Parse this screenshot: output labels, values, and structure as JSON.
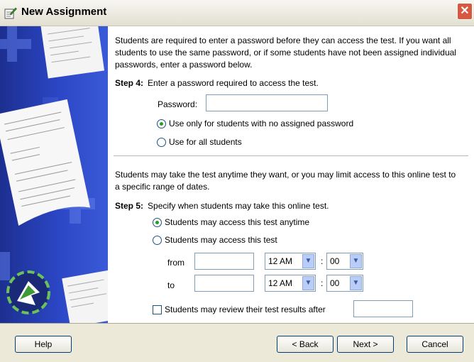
{
  "window": {
    "title": "New Assignment",
    "close_label": "✕"
  },
  "intro_text": "Students are required to enter a password before they can access the test. If you want all students to use the same password, or if some students have not been assigned individual passwords, enter a password below.",
  "step4": {
    "label": "Step 4:",
    "text": "Enter a password required to access the test.",
    "password_label": "Password:",
    "password_value": "",
    "options": [
      {
        "label": "Use only for students with no assigned password",
        "selected": true
      },
      {
        "label": "Use for all students",
        "selected": false
      }
    ]
  },
  "dates_text": "Students may take the test anytime they want, or you may limit access to this online test to a specific range of dates.",
  "step5": {
    "label": "Step 5:",
    "text": "Specify when students may take this online test.",
    "options": [
      {
        "label": "Students may access this test anytime",
        "selected": true
      },
      {
        "label": "Students may access this test",
        "selected": false
      }
    ],
    "from_label": "from",
    "to_label": "to",
    "from_date": "",
    "to_date": "",
    "from_hour": "12 AM",
    "from_minute": "00",
    "to_hour": "12 AM",
    "to_minute": "00",
    "time_separator": ":",
    "review_label": "Students may review their test results after",
    "review_checked": false,
    "review_value": ""
  },
  "buttons": {
    "help": "Help",
    "back": "< Back",
    "next": "Next >",
    "cancel": "Cancel"
  },
  "colors": {
    "side_panel": "#2c47c6",
    "background": "#ece9d8",
    "selected_radio": "#21a121"
  }
}
